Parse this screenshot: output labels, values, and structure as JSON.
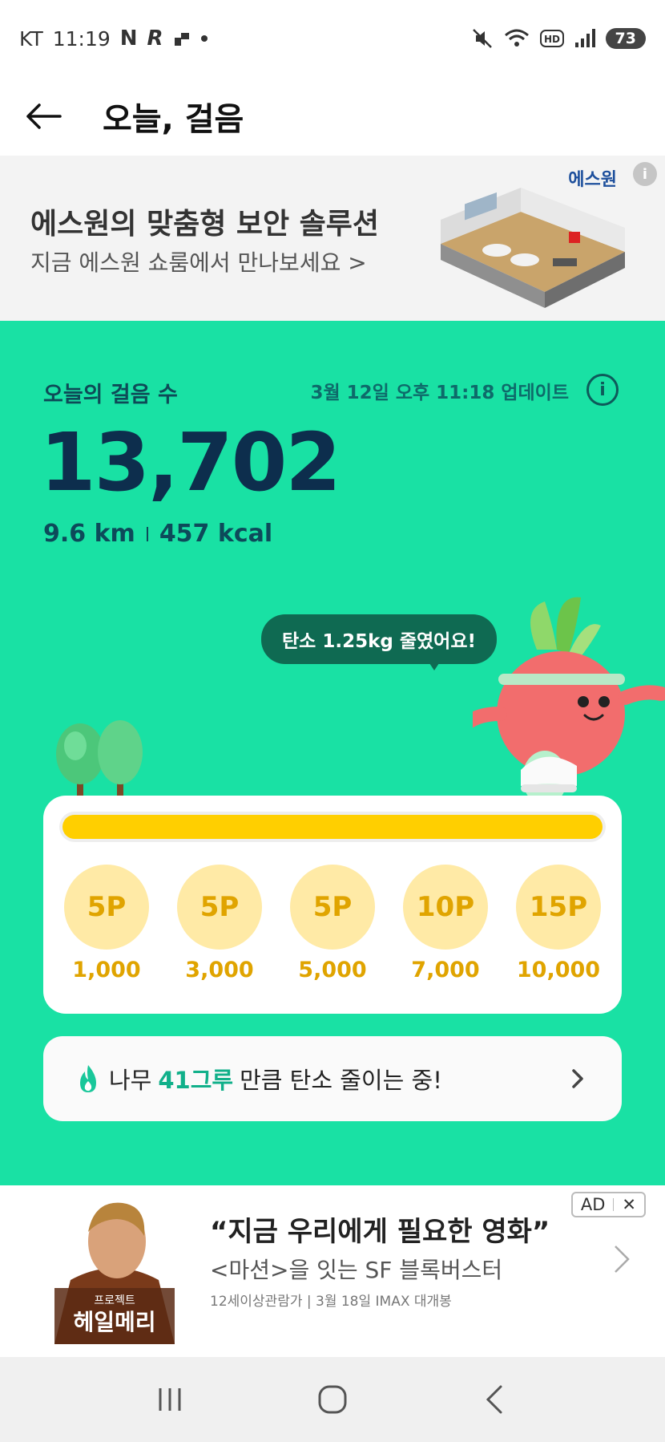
{
  "status_bar": {
    "carrier": "KT",
    "time": "11:19",
    "battery": "73",
    "icons_left": [
      "N",
      "R"
    ],
    "icons_right": [
      "mute-icon",
      "wifi-icon",
      "hd-icon",
      "signal-icon"
    ]
  },
  "header": {
    "title": "오늘, 걸음"
  },
  "banner_ad": {
    "brand": "에스원",
    "info_icon": "i",
    "title": "에스원의 맞춤형 보안 솔루션",
    "subtitle": "지금 에스원 쇼룸에서 만나보세요 >"
  },
  "steps": {
    "label": "오늘의 걸음 수",
    "update_text": "3월 12일 오후 11:18 업데이트",
    "info_icon": "i",
    "count": "13,702",
    "distance": "9.6 km",
    "calories": "457 kcal",
    "bubble": "탄소 1.25kg 줄였어요!"
  },
  "progress": {
    "fraction": 1.0,
    "milestones": [
      {
        "points": "5P",
        "steps": "1,000"
      },
      {
        "points": "5P",
        "steps": "3,000"
      },
      {
        "points": "5P",
        "steps": "5,000"
      },
      {
        "points": "10P",
        "steps": "7,000"
      },
      {
        "points": "15P",
        "steps": "10,000"
      }
    ]
  },
  "tree_card": {
    "prefix": "나무",
    "count": "41그루",
    "suffix": "만큼 탄소 줄이는 중!"
  },
  "bottom_ad": {
    "title": "“지금 우리에게 필요한 영화”",
    "subtitle": "<마션>을 잇는 SF 블록버스터",
    "small": "12세이상관람가 | 3월 18일 IMAX 대개봉",
    "badge": "AD",
    "close": "✕",
    "poster_text_small": "프로젝트",
    "poster_text": "헤일메리"
  },
  "colors": {
    "green_bg": "#19e1a4",
    "progress_fill": "#ffcf00",
    "point_circle": "#ffeaa6",
    "dark_text": "#0d2e4d"
  }
}
